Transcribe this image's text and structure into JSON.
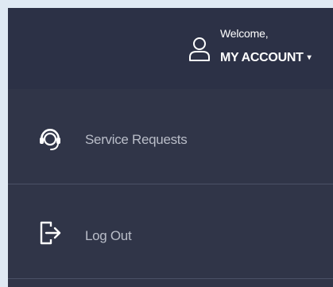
{
  "header": {
    "welcome_text": "Welcome,",
    "account_label": "MY ACCOUNT",
    "caret": "▾"
  },
  "menu": {
    "items": [
      {
        "label": "Service Requests",
        "icon": "headset-icon"
      },
      {
        "label": "Log Out",
        "icon": "logout-icon"
      }
    ]
  },
  "colors": {
    "page_background": "#dfe9f3",
    "header_background": "#2c3146",
    "menu_background": "#303548",
    "divider": "#4b5166",
    "menu_text": "#b9bdc8",
    "header_text": "#ffffff"
  }
}
